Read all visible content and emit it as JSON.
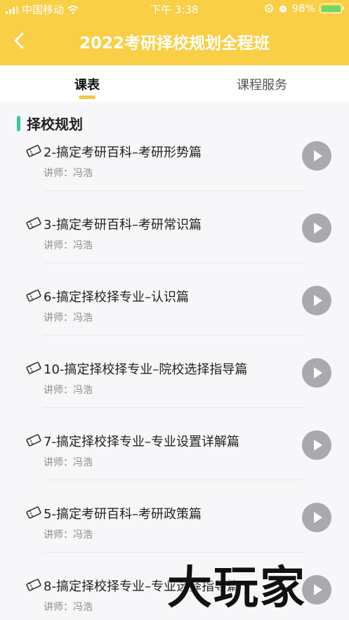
{
  "status_bar": {
    "carrier": "中国移动",
    "time": "下午 3:38",
    "battery": "98%"
  },
  "header": {
    "title": "2022考研择校规划全程班"
  },
  "tabs": [
    {
      "label": "课表"
    },
    {
      "label": "课程服务"
    }
  ],
  "section": {
    "title": "择校规划"
  },
  "lessons": [
    {
      "title": "2-搞定考研百科–考研形势篇",
      "teacher": "讲师：冯浩"
    },
    {
      "title": "3-搞定考研百科–考研常识篇",
      "teacher": "讲师：冯浩"
    },
    {
      "title": "6-搞定择校择专业–认识篇",
      "teacher": "讲师：冯浩"
    },
    {
      "title": "10-搞定择校择专业–院校选择指导篇",
      "teacher": "讲师：冯浩"
    },
    {
      "title": "7-搞定择校择专业–专业设置详解篇",
      "teacher": "讲师：冯浩"
    },
    {
      "title": "5-搞定考研百科–考研政策篇",
      "teacher": "讲师：冯浩"
    },
    {
      "title": "8-搞定择校择专业–专业选择指导篇",
      "teacher": "讲师：冯浩"
    }
  ],
  "watermark": "大玩家",
  "colors": {
    "header": "#f8cf45",
    "tab_indicator": "#f5c842",
    "section_bar": "#37c7a0",
    "play_button": "#a9a9ae",
    "battery_fill": "#6fd868"
  }
}
